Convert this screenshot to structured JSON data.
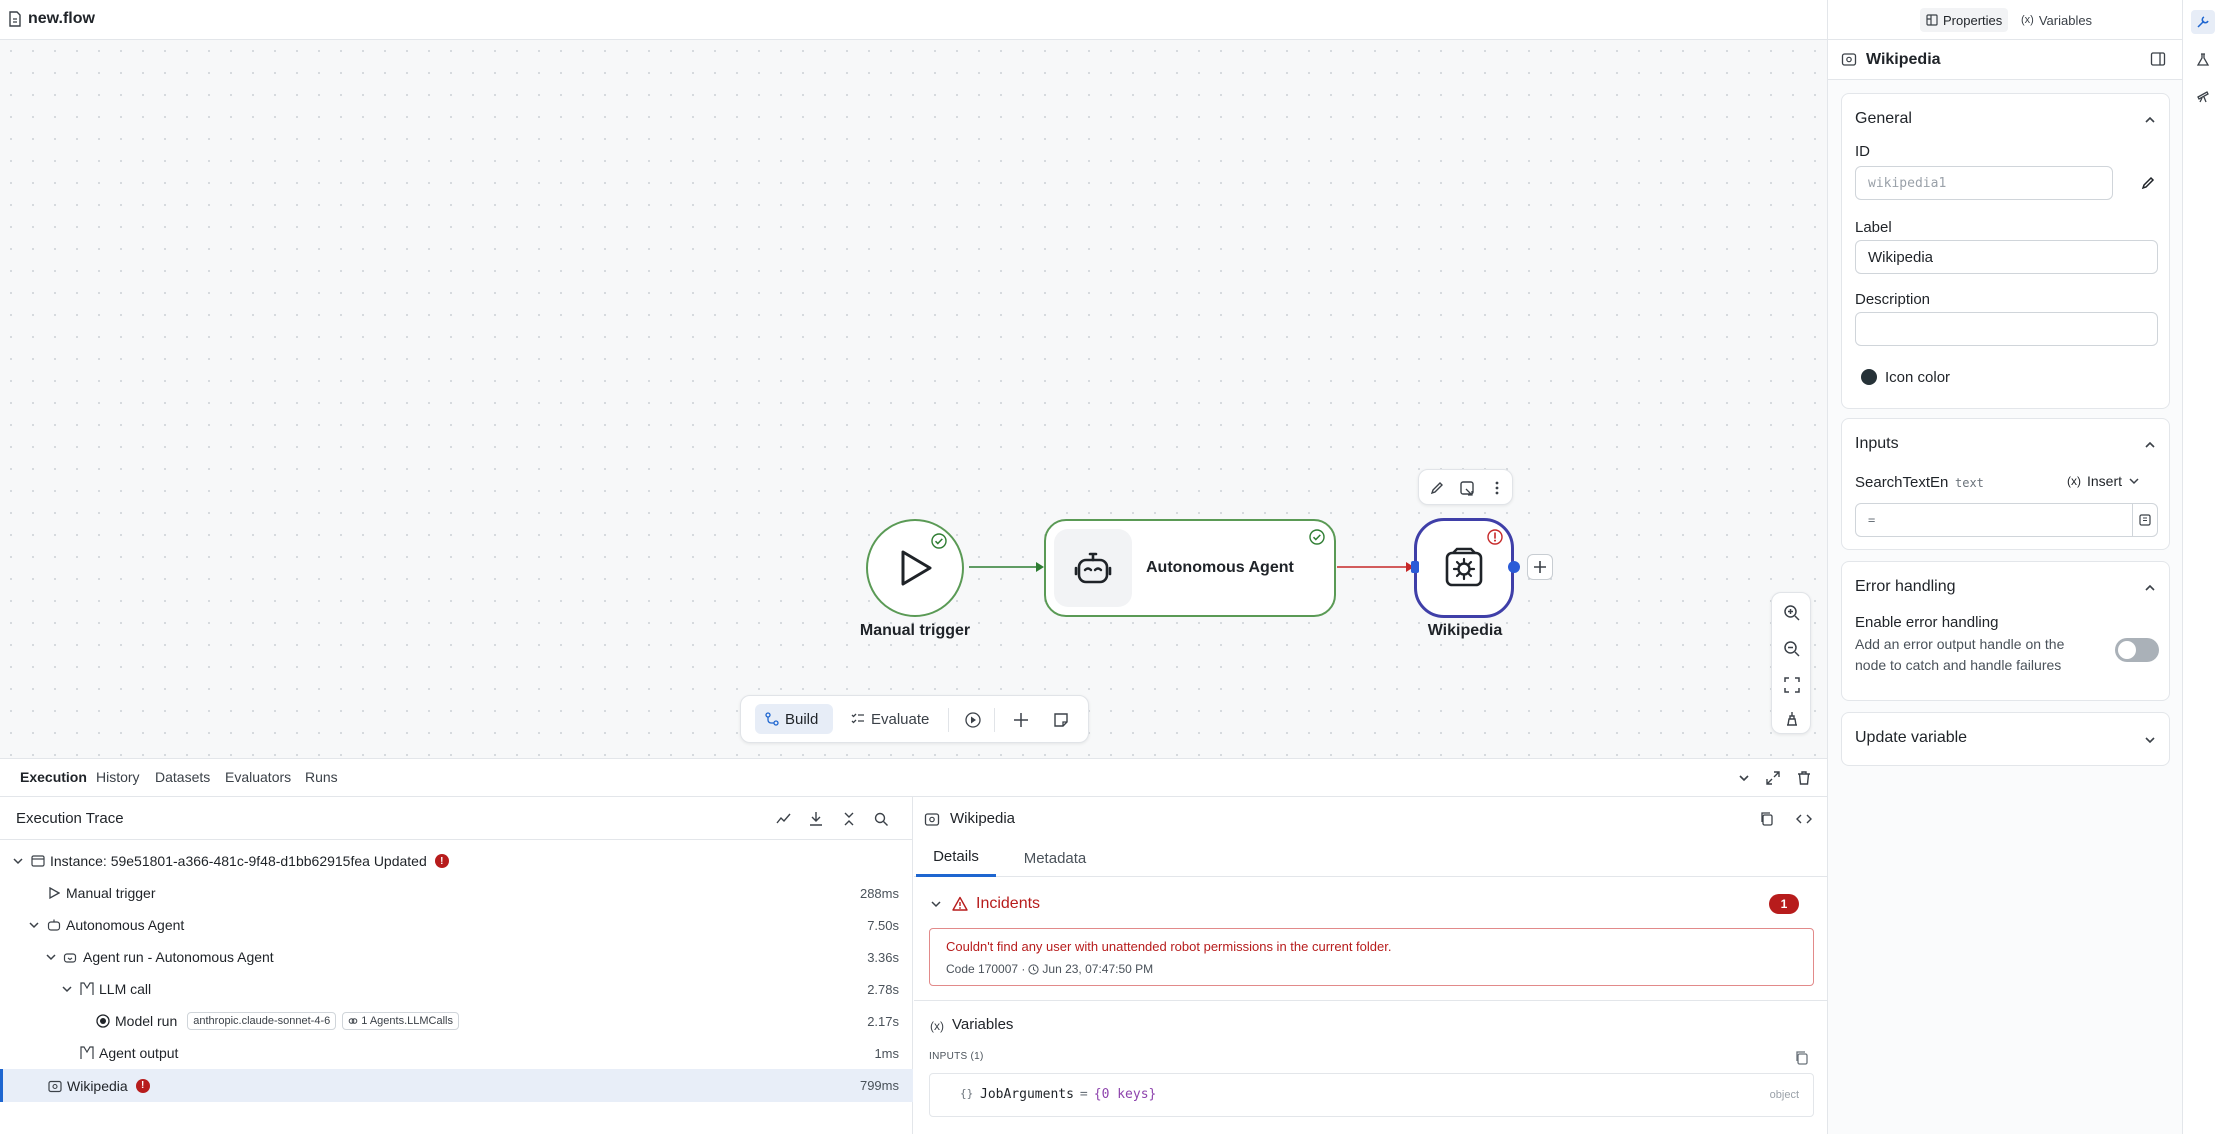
{
  "topbar": {
    "title": "new.flow"
  },
  "canvas": {
    "nodes": {
      "manual_trigger": "Manual trigger",
      "agent": "Autonomous Agent",
      "wikipedia": "Wikipedia"
    },
    "toolbar": {
      "build": "Build",
      "evaluate": "Evaluate"
    }
  },
  "props": {
    "tabs": {
      "properties": "Properties",
      "variables": "Variables"
    },
    "header": "Wikipedia",
    "general": {
      "title": "General",
      "id_label": "ID",
      "id_value": "wikipedia1",
      "label_label": "Label",
      "label_value": "Wikipedia",
      "description_label": "Description",
      "description_value": "",
      "icon_color_label": "Icon color",
      "icon_color": "#263238"
    },
    "inputs": {
      "title": "Inputs",
      "field_name": "SearchTextEn",
      "field_type": "text",
      "insert_label": "Insert",
      "field_value": "="
    },
    "error_handling": {
      "title": "Error handling",
      "enable_label": "Enable error handling",
      "enable_desc": "Add an error output handle on the node to catch and handle failures"
    },
    "update_variable": {
      "title": "Update variable"
    }
  },
  "bottom": {
    "tabs": [
      "Execution",
      "History",
      "Datasets",
      "Evaluators",
      "Runs"
    ],
    "trace_title": "Execution Trace",
    "trace": [
      {
        "label": "Instance: 59e51801-a366-481c-9f48-d1bb62915fea Updated",
        "duration": "",
        "error": true
      },
      {
        "label": "Manual trigger",
        "duration": "288ms"
      },
      {
        "label": "Autonomous Agent",
        "duration": "7.50s"
      },
      {
        "label": "Agent run - Autonomous Agent",
        "duration": "3.36s"
      },
      {
        "label": "LLM call",
        "duration": "2.78s"
      },
      {
        "label": "Model run",
        "duration": "2.17s",
        "chips": [
          "anthropic.claude-sonnet-4-6",
          "1 Agents.LLMCalls"
        ]
      },
      {
        "label": "Agent output",
        "duration": "1ms"
      },
      {
        "label": "Wikipedia",
        "duration": "799ms",
        "error": true
      }
    ],
    "detail": {
      "title": "Wikipedia",
      "tabs": {
        "details": "Details",
        "metadata": "Metadata"
      },
      "incidents_title": "Incidents",
      "incidents_count": "1",
      "error_message": "Couldn't find any user with unattended robot permissions in the current folder.",
      "error_meta": "Code 170007 · ",
      "error_time": "Jun 23, 07:47:50 PM",
      "variables_title": "Variables",
      "inputs_caption": "INPUTS (1)",
      "var_name": "JobArguments",
      "var_eq": "=",
      "var_value": "{0 keys}",
      "var_type": "object"
    }
  },
  "colors": {
    "accent": "#1e66d0",
    "success": "#2e7d32",
    "error": "#b71c1c",
    "node_border_selected": "#3f3fa8"
  }
}
